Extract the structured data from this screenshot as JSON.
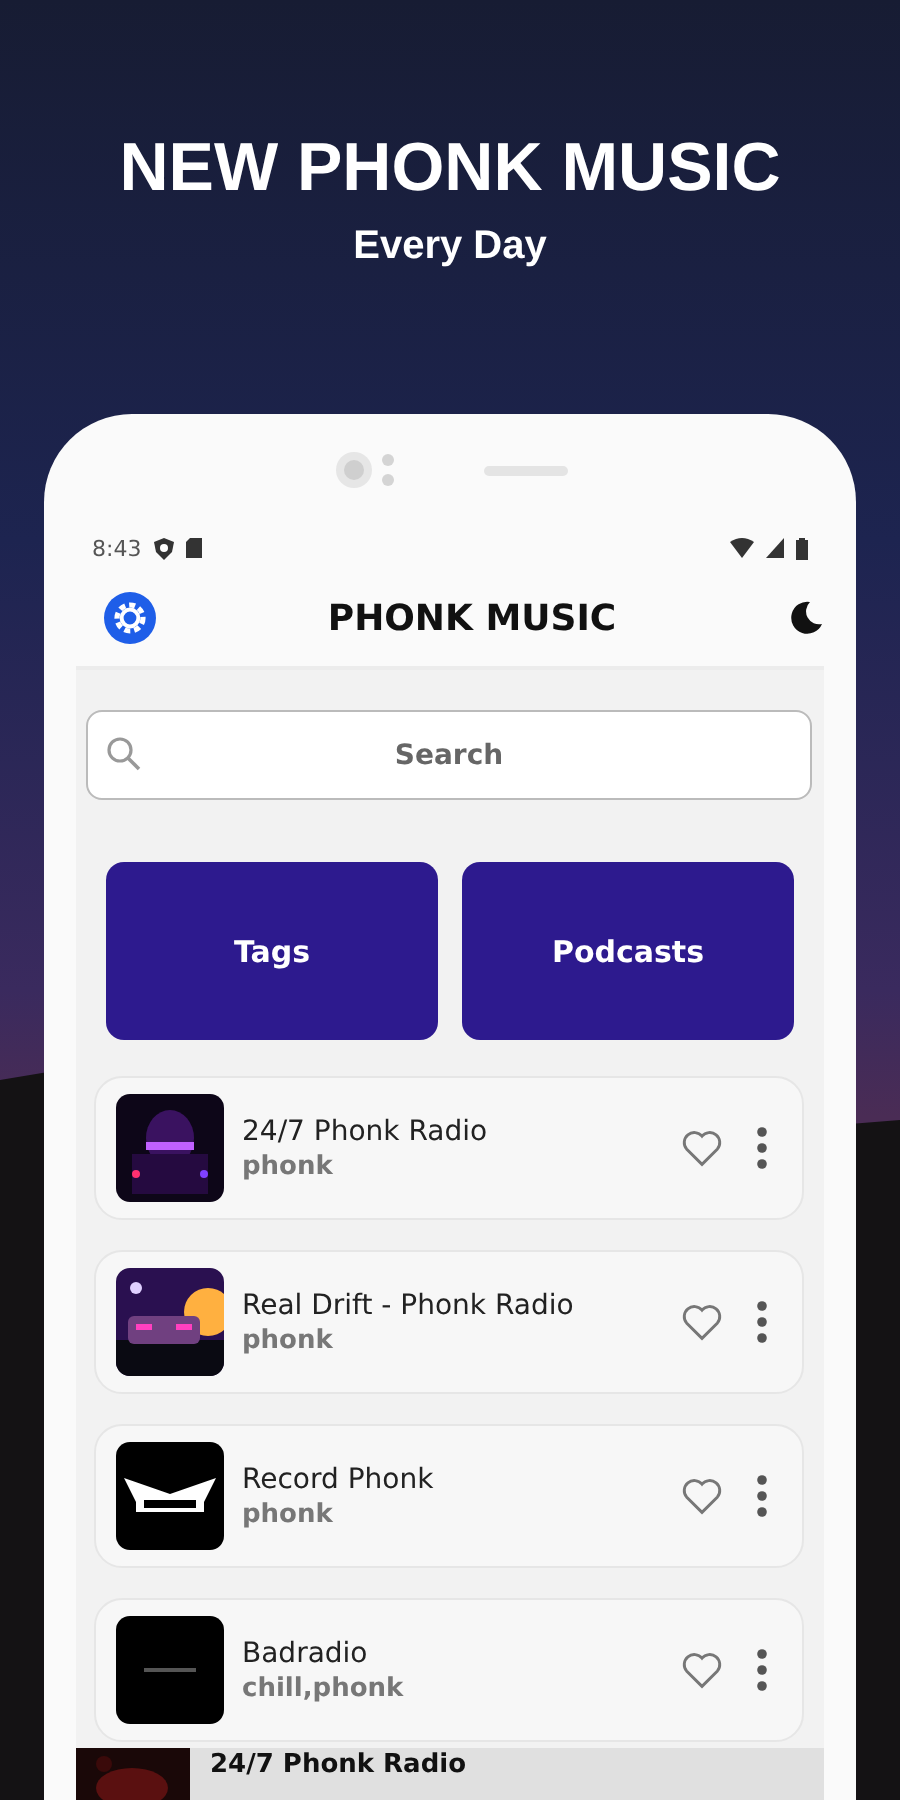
{
  "promo": {
    "title": "NEW PHONK MUSIC",
    "subtitle": "Every Day"
  },
  "status_bar": {
    "time": "8:43"
  },
  "app_bar": {
    "title": "PHONK MUSIC"
  },
  "search": {
    "placeholder": "Search"
  },
  "buttons": [
    "Tags",
    "Podcasts"
  ],
  "stations": [
    {
      "name": "24/7 Phonk Radio",
      "tags": "phonk",
      "favorite": false
    },
    {
      "name": "Real Drift - Phonk Radio",
      "tags": "phonk",
      "favorite": false
    },
    {
      "name": "Record Phonk",
      "tags": "phonk",
      "favorite": false
    },
    {
      "name": "Badradio",
      "tags": "chill,phonk",
      "favorite": false
    }
  ],
  "now_playing": {
    "name": "24/7 Phonk Radio"
  }
}
